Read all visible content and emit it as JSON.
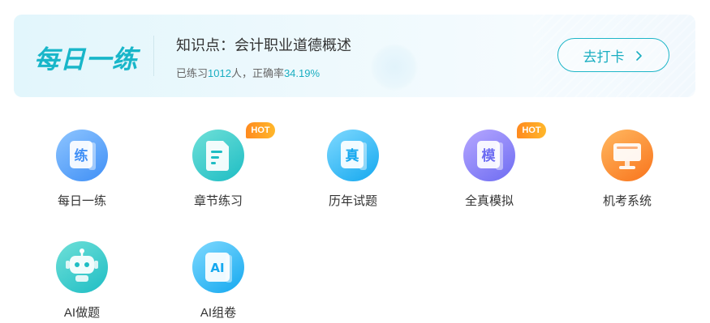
{
  "daily": {
    "title": "每日一练",
    "knowledge_point": "知识点：会计职业道德概述",
    "practiced_prefix": "已练习",
    "practiced_count": "1012",
    "practiced_suffix": "人，正确率",
    "accuracy": "34.19%",
    "checkin_label": "去打卡"
  },
  "features": [
    {
      "label": "每日一练",
      "glyph": "练",
      "icon": "daily-practice-icon",
      "hot": ""
    },
    {
      "label": "章节练习",
      "glyph": "",
      "icon": "chapter-document-icon",
      "hot": "HOT"
    },
    {
      "label": "历年试题",
      "glyph": "真",
      "icon": "past-exam-icon",
      "hot": ""
    },
    {
      "label": "全真模拟",
      "glyph": "模",
      "icon": "mock-exam-icon",
      "hot": "HOT"
    },
    {
      "label": "机考系统",
      "glyph": "",
      "icon": "computer-exam-icon",
      "hot": ""
    },
    {
      "label": "AI做题",
      "glyph": "",
      "icon": "ai-robot-icon",
      "hot": ""
    },
    {
      "label": "AI组卷",
      "glyph": "AI",
      "icon": "ai-paper-icon",
      "hot": ""
    }
  ],
  "colors": {
    "accent": "#1aaec1",
    "hot_badge": "#ff8a1f",
    "daily_blue": "#3f8ff6",
    "chapter_teal": "#1ebdc4",
    "past_sky": "#14a8ef",
    "mock_purple": "#6d6cf2",
    "computer_orange": "#f9741c"
  }
}
